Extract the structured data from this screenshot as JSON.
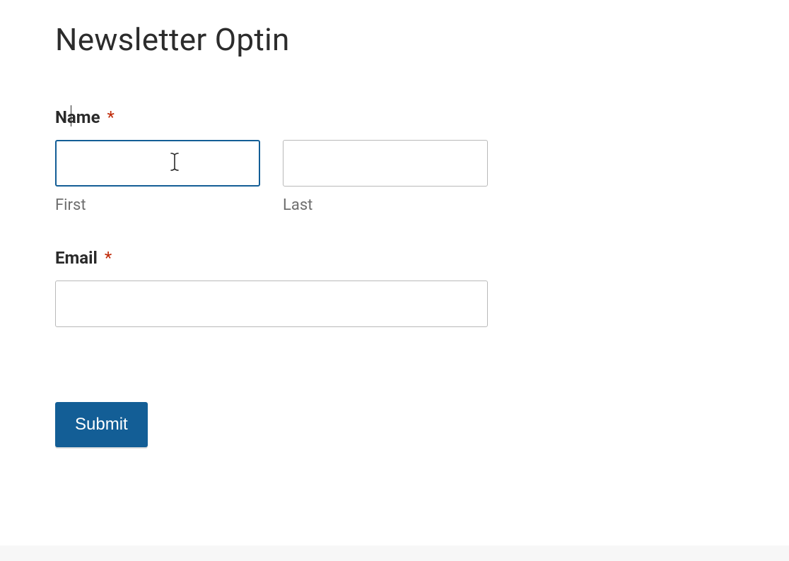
{
  "title": "Newsletter Optin",
  "fields": {
    "name": {
      "label": "Name",
      "required_mark": "*",
      "first": {
        "value": "",
        "sublabel": "First"
      },
      "last": {
        "value": "",
        "sublabel": "Last"
      }
    },
    "email": {
      "label": "Email",
      "required_mark": "*",
      "value": ""
    }
  },
  "submit": {
    "label": "Submit"
  },
  "colors": {
    "primary": "#135e96",
    "required": "#c02b0a"
  }
}
